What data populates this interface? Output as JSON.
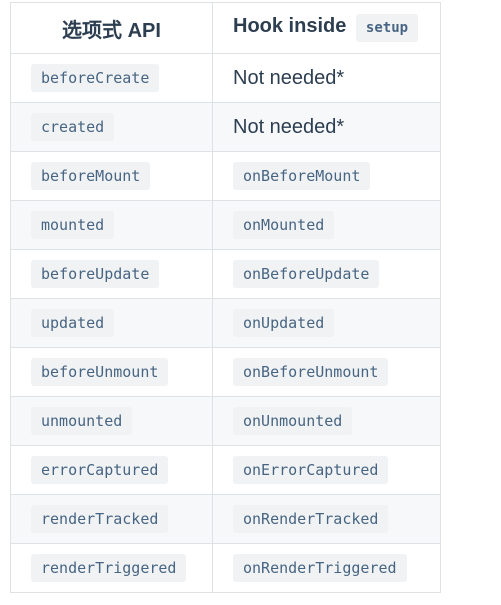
{
  "table": {
    "header": {
      "col1": "选项式 API",
      "col2_text": "Hook inside",
      "col2_code": "setup"
    },
    "rows": [
      {
        "option": "beforeCreate",
        "hook": "Not needed*",
        "hook_is_code": false
      },
      {
        "option": "created",
        "hook": "Not needed*",
        "hook_is_code": false
      },
      {
        "option": "beforeMount",
        "hook": "onBeforeMount",
        "hook_is_code": true
      },
      {
        "option": "mounted",
        "hook": "onMounted",
        "hook_is_code": true
      },
      {
        "option": "beforeUpdate",
        "hook": "onBeforeUpdate",
        "hook_is_code": true
      },
      {
        "option": "updated",
        "hook": "onUpdated",
        "hook_is_code": true
      },
      {
        "option": "beforeUnmount",
        "hook": "onBeforeUnmount",
        "hook_is_code": true
      },
      {
        "option": "unmounted",
        "hook": "onUnmounted",
        "hook_is_code": true
      },
      {
        "option": "errorCaptured",
        "hook": "onErrorCaptured",
        "hook_is_code": true
      },
      {
        "option": "renderTracked",
        "hook": "onRenderTracked",
        "hook_is_code": true
      },
      {
        "option": "renderTriggered",
        "hook": "onRenderTriggered",
        "hook_is_code": true
      }
    ]
  }
}
